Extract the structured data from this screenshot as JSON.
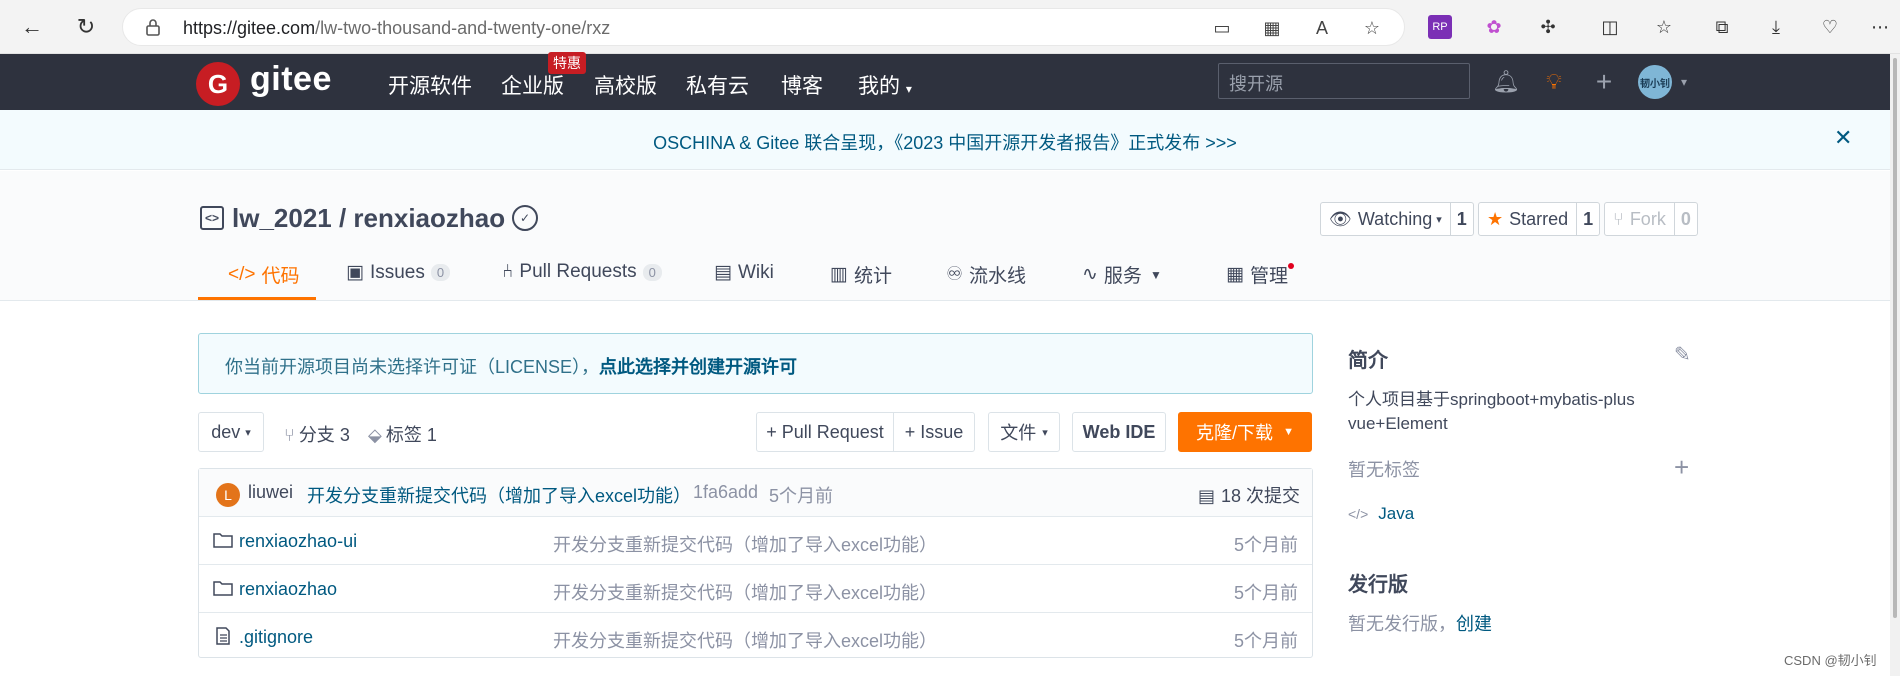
{
  "browser": {
    "url_host": "https://gitee.com",
    "url_path": "/lw-two-thousand-and-twenty-one/rxz"
  },
  "topnav": {
    "logo_text": "gitee",
    "items": [
      "开源软件",
      "企业版",
      "高校版",
      "私有云",
      "博客",
      "我的"
    ],
    "hot_badge": "特惠",
    "search_placeholder": "搜开源",
    "avatar_text": "韧小钊"
  },
  "banner": {
    "text": "OSCHINA & Gitee 联合呈现，《2023 中国开源开发者报告》正式发布 >>>"
  },
  "repo": {
    "title": "lw_2021 / renxiaozhao",
    "watching_label": "Watching",
    "watching_count": "1",
    "starred_label": "Starred",
    "starred_count": "1",
    "fork_label": "Fork",
    "fork_count": "0"
  },
  "tabs": [
    {
      "label": "代码",
      "icon": "code-icon"
    },
    {
      "label": "Issues",
      "count": "0",
      "icon": "issues-icon"
    },
    {
      "label": "Pull Requests",
      "count": "0",
      "icon": "pull-request-icon"
    },
    {
      "label": "Wiki",
      "icon": "wiki-icon"
    },
    {
      "label": "统计",
      "icon": "stats-icon"
    },
    {
      "label": "流水线",
      "icon": "pipeline-icon"
    },
    {
      "label": "服务",
      "icon": "service-icon"
    },
    {
      "label": "管理",
      "icon": "manage-icon"
    }
  ],
  "license": {
    "text": "你当前开源项目尚未选择许可证（LICENSE），",
    "link": "点此选择并创建开源许可"
  },
  "toolbar": {
    "branch": "dev",
    "branches": "分支 3",
    "tags": "标签 1",
    "pull_request_btn": "+ Pull Request",
    "issue_btn": "+ Issue",
    "file_btn": "文件",
    "web_ide_btn": "Web IDE",
    "clone_btn": "克隆/下载"
  },
  "commit": {
    "avatar_letter": "L",
    "author": "liuwei",
    "message": "开发分支重新提交代码（增加了导入excel功能）",
    "hash": "1fa6add",
    "time": "5个月前",
    "total": "18 次提交"
  },
  "files": [
    {
      "name": "renxiaozhao-ui",
      "type": "folder",
      "message": "开发分支重新提交代码（增加了导入excel功能）",
      "time": "5个月前"
    },
    {
      "name": "renxiaozhao",
      "type": "folder",
      "message": "开发分支重新提交代码（增加了导入excel功能）",
      "time": "5个月前"
    },
    {
      "name": ".gitignore",
      "type": "file",
      "message": "开发分支重新提交代码（增加了导入excel功能）",
      "time": "5个月前"
    }
  ],
  "sidebar": {
    "intro_title": "简介",
    "intro_text": "个人项目基于springboot+mybatis-plus vue+Element",
    "no_tags": "暂无标签",
    "language": "Java",
    "release_title": "发行版",
    "no_release": "暂无发行版，",
    "create_link": "创建"
  },
  "watermark": "CSDN @韧小钊",
  "colors": {
    "accent": "#fe7300",
    "nav_bg": "#2e323e",
    "link": "#005980",
    "brand_red": "#c71d23"
  }
}
